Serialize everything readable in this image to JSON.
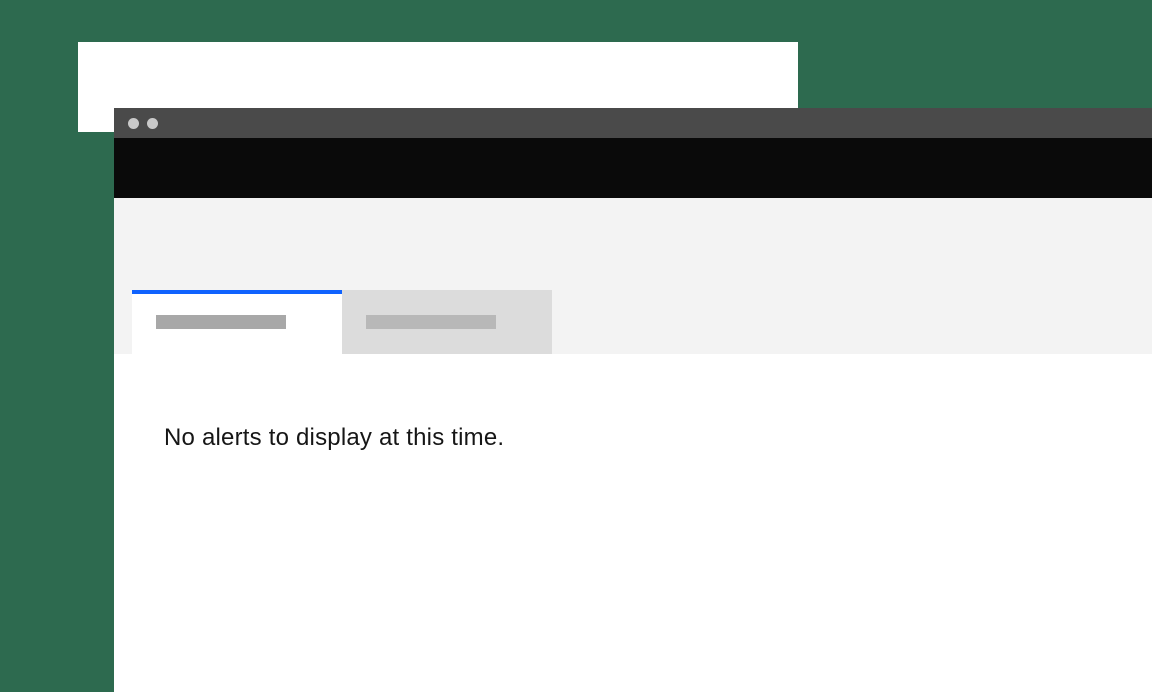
{
  "tabs": {
    "active_label": "",
    "inactive_label": ""
  },
  "content": {
    "empty_message": "No alerts to display at this time."
  },
  "colors": {
    "accent": "#0f62fe",
    "page_bg": "#2d6a4f"
  }
}
